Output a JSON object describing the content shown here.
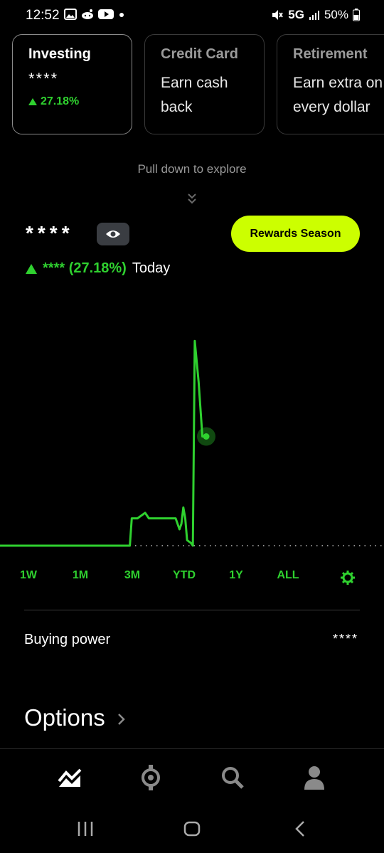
{
  "status_bar": {
    "time": "12:52",
    "network": "5G",
    "battery": "50%"
  },
  "cards": [
    {
      "title": "Investing",
      "value": "****",
      "change": "27.18%"
    },
    {
      "title": "Credit Card",
      "body_line1": "Earn cash",
      "body_line2": "back"
    },
    {
      "title": "Retirement",
      "body_line1": "Earn extra on",
      "body_line2": "every dollar"
    }
  ],
  "pull_hint": "Pull down to explore",
  "portfolio": {
    "value": "****",
    "change": "**** (27.18%)",
    "change_period": "Today"
  },
  "rewards_button": "Rewards Season",
  "chart_data": {
    "type": "line",
    "color": "#2fd12f",
    "baseline_style": "dotted",
    "x": [
      0,
      10,
      20,
      30,
      34,
      34.5,
      36,
      38,
      39,
      40,
      42,
      44,
      45,
      46,
      47,
      47.5,
      48,
      48.5,
      49,
      50,
      50.5,
      51,
      52,
      53,
      54
    ],
    "y": [
      0,
      0,
      0,
      0,
      0,
      10,
      10,
      12,
      10,
      10,
      10,
      10,
      10,
      10,
      6,
      8,
      14,
      10,
      2,
      1,
      0,
      75,
      60,
      40,
      40
    ]
  },
  "ranges": [
    "1W",
    "1M",
    "3M",
    "YTD",
    "1Y",
    "ALL"
  ],
  "buying_power": {
    "label": "Buying power",
    "value": "****"
  },
  "options": {
    "title": "Options"
  },
  "bottom_nav": [
    "investing-icon",
    "crypto-icon",
    "search-icon",
    "account-icon"
  ],
  "colors": {
    "accent": "#ccff00",
    "green": "#2fd12f",
    "background": "#000000"
  }
}
